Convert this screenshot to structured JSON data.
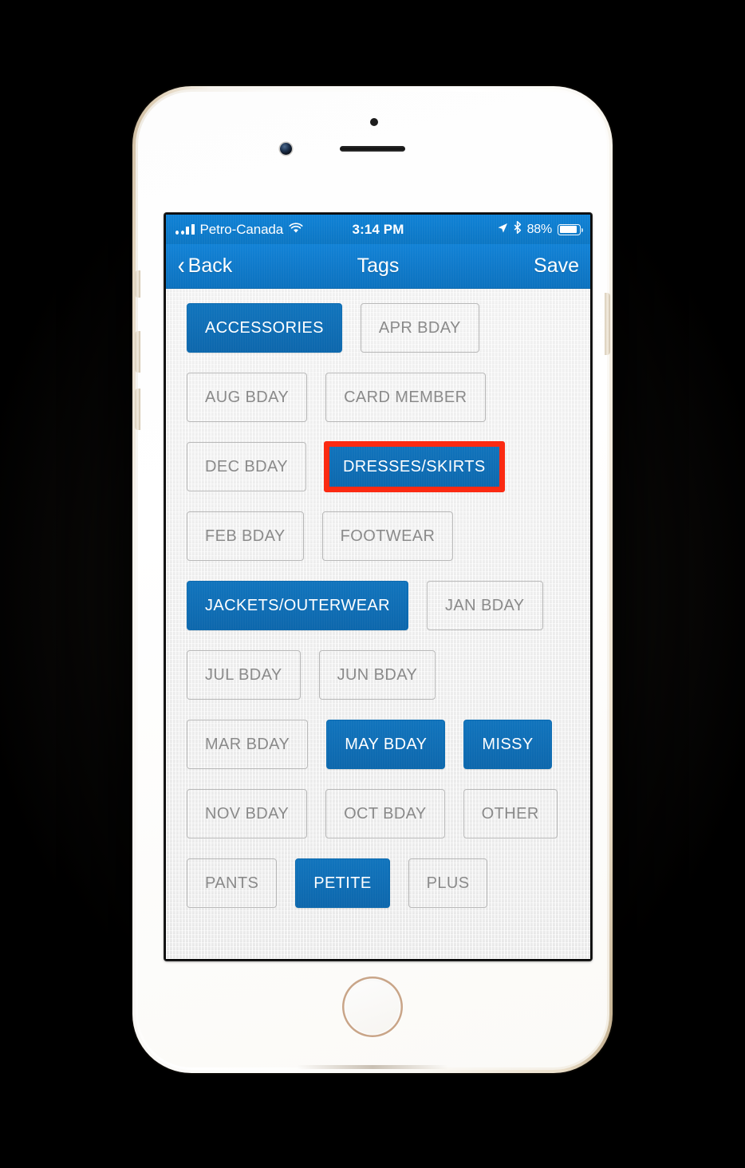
{
  "status_bar": {
    "carrier": "Petro-Canada",
    "time": "3:14 PM",
    "battery_percent": "88%",
    "signal_icon": "signal-bars-icon",
    "wifi_icon": "wifi-icon",
    "location_icon": "location-arrow-icon",
    "bluetooth_icon": "bluetooth-icon",
    "battery_icon": "battery-icon"
  },
  "nav_bar": {
    "back_label": "Back",
    "back_chevron": "‹",
    "title": "Tags",
    "save_label": "Save"
  },
  "colors": {
    "accent_blue": "#0f6db4",
    "nav_blue": "#0f79c9",
    "highlight_red": "#fb2a12",
    "screen_bg": "#efefef",
    "tag_border_off": "#b9b9b9",
    "tag_text_off": "#8a8a8a"
  },
  "tags": [
    {
      "label": "ACCESSORIES",
      "selected": true
    },
    {
      "label": "APR BDAY",
      "selected": false
    },
    {
      "label": "AUG BDAY",
      "selected": false
    },
    {
      "label": "CARD MEMBER",
      "selected": false
    },
    {
      "label": "DEC BDAY",
      "selected": false
    },
    {
      "label": "DRESSES/SKIRTS",
      "selected": true
    },
    {
      "label": "FEB BDAY",
      "selected": false
    },
    {
      "label": "FOOTWEAR",
      "selected": false
    },
    {
      "label": "JACKETS/OUTERWEAR",
      "selected": true
    },
    {
      "label": "JAN BDAY",
      "selected": false
    },
    {
      "label": "JUL BDAY",
      "selected": false
    },
    {
      "label": "JUN BDAY",
      "selected": false
    },
    {
      "label": "MAR BDAY",
      "selected": false
    },
    {
      "label": "MAY BDAY",
      "selected": true
    },
    {
      "label": "MISSY",
      "selected": true
    },
    {
      "label": "NOV BDAY",
      "selected": false
    },
    {
      "label": "OCT BDAY",
      "selected": false
    },
    {
      "label": "OTHER",
      "selected": false
    },
    {
      "label": "PANTS",
      "selected": false
    },
    {
      "label": "PETITE",
      "selected": true
    },
    {
      "label": "PLUS",
      "selected": false
    }
  ],
  "annotation": {
    "type": "highlight-rectangle",
    "target_tag": "DRESSES/SKIRTS"
  }
}
